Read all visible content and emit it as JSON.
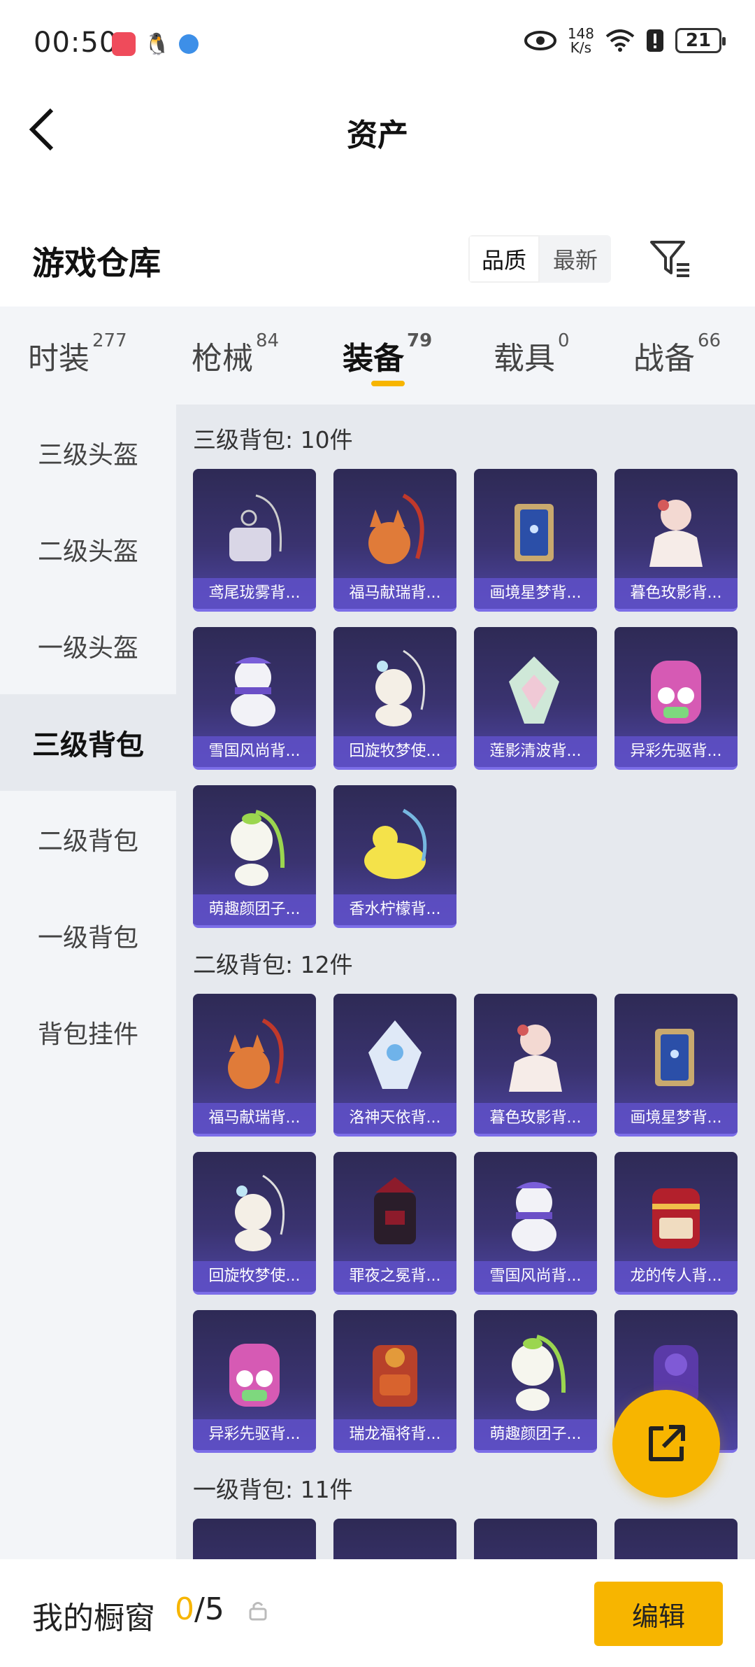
{
  "status_bar": {
    "time": "00:50",
    "speed_value": "148",
    "speed_unit": "K/s",
    "battery": "21"
  },
  "nav": {
    "title": "资产"
  },
  "warehouse": {
    "title": "游戏仓库",
    "sort_options": [
      "品质",
      "最新"
    ],
    "sort_selected": "品质"
  },
  "tabs": [
    {
      "label": "时装",
      "count": "277"
    },
    {
      "label": "枪械",
      "count": "84"
    },
    {
      "label": "装备",
      "count": "79"
    },
    {
      "label": "载具",
      "count": "0"
    },
    {
      "label": "战备",
      "count": "66"
    }
  ],
  "active_tab": "装备",
  "sidebar": {
    "items": [
      "三级头盔",
      "二级头盔",
      "一级头盔",
      "三级背包",
      "二级背包",
      "一级背包",
      "背包挂件"
    ],
    "active": "三级背包"
  },
  "sections": [
    {
      "title": "三级背包: 10件",
      "items": [
        "鸢尾珑雾背...",
        "福马献瑞背...",
        "画境星梦背...",
        "暮色玫影背...",
        "雪国风尚背...",
        "回旋牧梦使...",
        "莲影清波背...",
        "异彩先驱背...",
        "萌趣颜团子...",
        "香水柠檬背..."
      ]
    },
    {
      "title": "二级背包: 12件",
      "items": [
        "福马献瑞背...",
        "洛神天依背...",
        "暮色玫影背...",
        "画境星梦背...",
        "回旋牧梦使...",
        "罪夜之冕背...",
        "雪国风尚背...",
        "龙的传人背...",
        "异彩先驱背...",
        "瑞龙福将背...",
        "萌趣颜团子...",
        ""
      ]
    },
    {
      "title": "一级背包: 11件",
      "items": []
    }
  ],
  "bottom": {
    "label": "我的橱窗",
    "current": "0",
    "total": "/5",
    "edit_label": "编辑"
  },
  "colors": {
    "accent": "#f7b500",
    "card_bg": "#3a3370",
    "card_name_bg": "#5f50c8"
  }
}
